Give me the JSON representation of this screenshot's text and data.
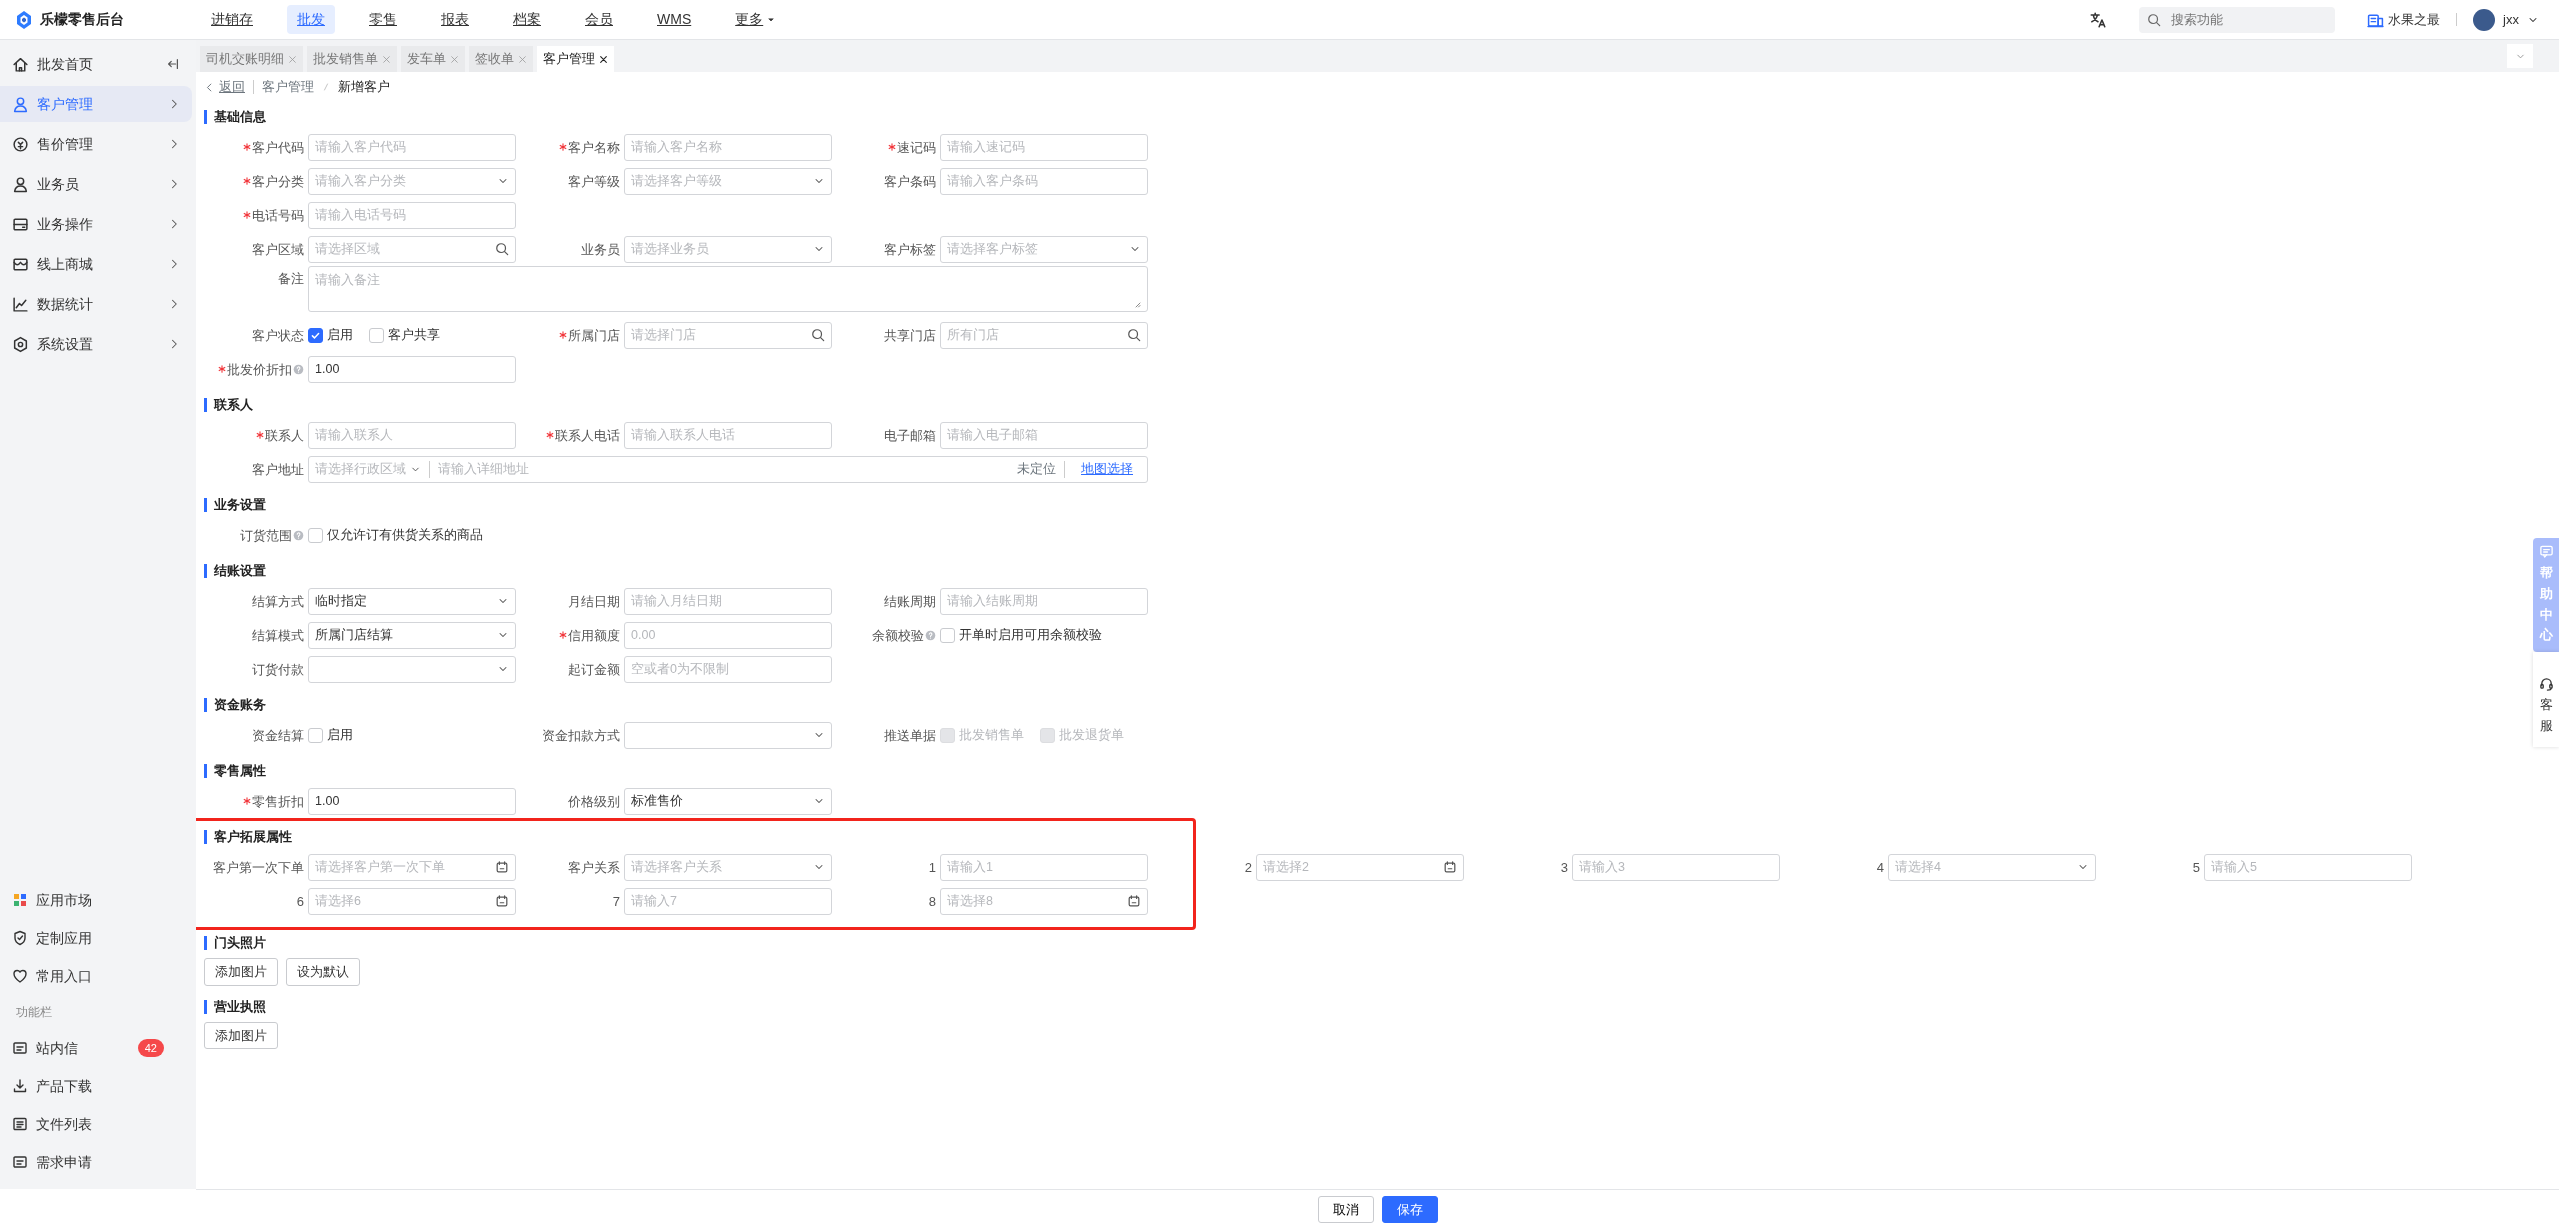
{
  "app": {
    "name": "乐檬零售后台"
  },
  "top_nav": [
    {
      "label": "进销存",
      "selected": false
    },
    {
      "label": "批发",
      "selected": true
    },
    {
      "label": "零售",
      "selected": false
    },
    {
      "label": "报表",
      "selected": false
    },
    {
      "label": "档案",
      "selected": false
    },
    {
      "label": "会员",
      "selected": false
    },
    {
      "label": "WMS",
      "selected": false
    },
    {
      "label": "更多",
      "selected": false
    }
  ],
  "header": {
    "search_placeholder": "搜索功能",
    "store": "水果之最",
    "user": "jxx"
  },
  "sidebar": {
    "items": [
      {
        "label": "批发首页",
        "selected": false
      },
      {
        "label": "客户管理",
        "selected": true
      },
      {
        "label": "售价管理",
        "selected": false
      },
      {
        "label": "业务员",
        "selected": false
      },
      {
        "label": "业务操作",
        "selected": false
      },
      {
        "label": "线上商城",
        "selected": false
      },
      {
        "label": "数据统计",
        "selected": false
      },
      {
        "label": "系统设置",
        "selected": false
      }
    ],
    "shortcuts": [
      "应用市场",
      "定制应用",
      "常用入口"
    ],
    "section_label": "功能栏",
    "tools": [
      {
        "label": "站内信",
        "badge": "42"
      },
      {
        "label": "产品下载"
      },
      {
        "label": "文件列表"
      },
      {
        "label": "需求申请"
      }
    ]
  },
  "tabs": [
    {
      "label": "司机交账明细",
      "selected": false
    },
    {
      "label": "批发销售单",
      "selected": false
    },
    {
      "label": "发车单",
      "selected": false
    },
    {
      "label": "签收单",
      "selected": false
    },
    {
      "label": "客户管理",
      "selected": true
    }
  ],
  "breadcrumb": {
    "back": "返回",
    "path": [
      "客户管理",
      "新增客户"
    ]
  },
  "sections": [
    {
      "title": "基础信息",
      "rows": [
        [
          {
            "label": "客户代码",
            "required": true,
            "kind": "input",
            "placeholder": "请输入客户代码"
          },
          {
            "label": "客户名称",
            "required": true,
            "kind": "input",
            "placeholder": "请输入客户名称"
          },
          {
            "label": "速记码",
            "required": true,
            "kind": "input",
            "placeholder": "请输入速记码"
          }
        ],
        [
          {
            "label": "客户分类",
            "required": true,
            "kind": "select",
            "placeholder": "请输入客户分类"
          },
          {
            "label": "客户等级",
            "required": false,
            "kind": "select",
            "placeholder": "请选择客户等级"
          },
          {
            "label": "客户条码",
            "required": false,
            "kind": "input",
            "placeholder": "请输入客户条码"
          }
        ],
        [
          {
            "label": "电话号码",
            "required": true,
            "kind": "input",
            "placeholder": "请输入电话号码"
          }
        ],
        [
          {
            "label": "客户区域",
            "required": false,
            "kind": "search",
            "placeholder": "请选择区域"
          },
          {
            "label": "业务员",
            "required": false,
            "kind": "select",
            "placeholder": "请选择业务员"
          },
          {
            "label": "客户标签",
            "required": false,
            "kind": "select",
            "placeholder": "请选择客户标签"
          }
        ],
        [
          {
            "label": "备注",
            "required": false,
            "kind": "textarea",
            "placeholder": "请输入备注"
          }
        ],
        [
          {
            "label": "客户状态",
            "required": false,
            "kind": "checks",
            "options": [
              {
                "label": "启用",
                "checked": true,
                "disabled": false
              },
              {
                "label": "客户共享",
                "checked": false,
                "disabled": false
              }
            ]
          },
          {
            "label": "所属门店",
            "required": true,
            "kind": "search",
            "placeholder": "请选择门店"
          },
          {
            "label": "共享门店",
            "required": false,
            "kind": "search",
            "placeholder": "所有门店"
          }
        ],
        [
          {
            "label": "批发价折扣",
            "required": true,
            "help": true,
            "kind": "input",
            "value": "1.00"
          }
        ]
      ]
    },
    {
      "title": "联系人",
      "rows": [
        [
          {
            "label": "联系人",
            "required": true,
            "kind": "input",
            "placeholder": "请输入联系人"
          },
          {
            "label": "联系人电话",
            "required": true,
            "kind": "input",
            "placeholder": "请输入联系人电话"
          },
          {
            "label": "电子邮箱",
            "required": false,
            "kind": "input",
            "placeholder": "请输入电子邮箱"
          }
        ],
        [
          {
            "label": "客户地址",
            "required": false,
            "kind": "address",
            "region_placeholder": "请选择行政区域",
            "placeholder": "请输入详细地址",
            "status": "未定位",
            "link": "地图选择"
          }
        ]
      ]
    },
    {
      "title": "业务设置",
      "rows": [
        [
          {
            "label": "订货范围",
            "required": false,
            "help": true,
            "kind": "checks",
            "options": [
              {
                "label": "仅允许订有供货关系的商品",
                "checked": false,
                "disabled": false
              }
            ]
          }
        ]
      ]
    },
    {
      "title": "结账设置",
      "rows": [
        [
          {
            "label": "结算方式",
            "required": false,
            "kind": "select",
            "value": "临时指定"
          },
          {
            "label": "月结日期",
            "required": false,
            "kind": "input",
            "placeholder": "请输入月结日期"
          },
          {
            "label": "结账周期",
            "required": false,
            "kind": "input",
            "placeholder": "请输入结账周期"
          }
        ],
        [
          {
            "label": "结算模式",
            "required": false,
            "kind": "select",
            "value": "所属门店结算"
          },
          {
            "label": "信用额度",
            "required": true,
            "kind": "input",
            "placeholder": "0.00"
          },
          {
            "label": "余额校验",
            "required": false,
            "help": true,
            "kind": "checks",
            "options": [
              {
                "label": "开单时启用可用余额校验",
                "checked": false,
                "disabled": false
              }
            ]
          }
        ],
        [
          {
            "label": "订货付款",
            "required": false,
            "kind": "select"
          },
          {
            "label": "起订金额",
            "required": false,
            "kind": "input",
            "placeholder": "空或者0为不限制"
          }
        ]
      ]
    },
    {
      "title": "资金账务",
      "rows": [
        [
          {
            "label": "资金结算",
            "required": false,
            "kind": "checks",
            "options": [
              {
                "label": "启用",
                "checked": false,
                "disabled": false
              }
            ]
          },
          {
            "label": "资金扣款方式",
            "required": false,
            "kind": "select"
          },
          {
            "label": "推送单据",
            "required": false,
            "kind": "checks",
            "options": [
              {
                "label": "批发销售单",
                "checked": false,
                "disabled": true
              },
              {
                "label": "批发退货单",
                "checked": false,
                "disabled": true
              }
            ]
          }
        ]
      ]
    },
    {
      "title": "零售属性",
      "rows": [
        [
          {
            "label": "零售折扣",
            "required": true,
            "kind": "input",
            "value": "1.00"
          },
          {
            "label": "价格级别",
            "required": false,
            "kind": "select",
            "value": "标准售价"
          }
        ]
      ]
    },
    {
      "title": "客户拓展属性",
      "highlighted": true,
      "rows": [
        [
          {
            "label": "客户第一次下单",
            "required": false,
            "kind": "date",
            "placeholder": "请选择客户第一次下单"
          },
          {
            "label": "客户关系",
            "required": false,
            "kind": "select",
            "placeholder": "请选择客户关系"
          },
          {
            "label": "1",
            "required": false,
            "kind": "input",
            "placeholder": "请输入1"
          },
          {
            "label": "2",
            "required": false,
            "kind": "date",
            "placeholder": "请选择2"
          },
          {
            "label": "3",
            "required": false,
            "kind": "input",
            "placeholder": "请输入3"
          },
          {
            "label": "4",
            "required": false,
            "kind": "select",
            "placeholder": "请选择4"
          },
          {
            "label": "5",
            "required": false,
            "kind": "input",
            "placeholder": "请输入5"
          }
        ],
        [
          {
            "label": "6",
            "required": false,
            "kind": "date",
            "placeholder": "请选择6"
          },
          {
            "label": "7",
            "required": false,
            "kind": "input",
            "placeholder": "请输入7"
          },
          {
            "label": "8",
            "required": false,
            "kind": "date",
            "placeholder": "请选择8"
          }
        ]
      ]
    },
    {
      "title": "门头照片",
      "buttons": [
        "添加图片",
        "设为默认"
      ]
    },
    {
      "title": "营业执照",
      "buttons": [
        "添加图片"
      ]
    }
  ],
  "footer": {
    "buttons": [
      {
        "label": "取消",
        "kind": "secondary"
      },
      {
        "label": "保存",
        "kind": "primary"
      }
    ]
  },
  "floats": {
    "help": "帮助中心",
    "service": "客服"
  }
}
